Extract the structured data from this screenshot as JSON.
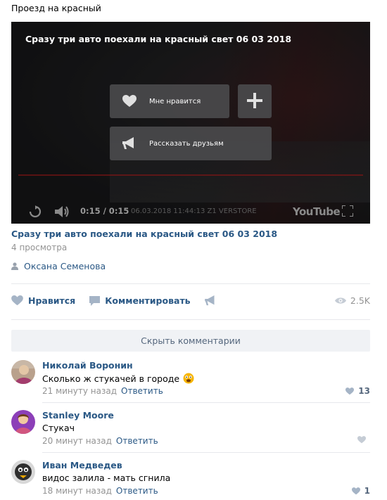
{
  "post": {
    "title": "Проезд на красный"
  },
  "player": {
    "heading": "Сразу три авто поехали на красный свет 06 03 2018",
    "overlay": {
      "like_label": "Мне нравится",
      "share_label": "Рассказать друзьям"
    },
    "time": "0:15 / 0:15",
    "stamp": "06.03.2018 11:44:13 Z1 VERSTORE",
    "brand": "YouTube",
    "progress": 1.0
  },
  "video": {
    "title": "Сразу три авто поехали на красный свет 06 03 2018",
    "views": "4 просмотра",
    "author": "Оксана Семенова"
  },
  "actions": {
    "like_label": "Нравится",
    "comment_label": "Комментировать",
    "views_count": "2.5K"
  },
  "comments_toggle": "Скрыть комментарии",
  "comments": [
    {
      "name": "Николай Воронин",
      "text": "Сколько ж стукачей в городе",
      "time": "21 минуту назад",
      "reply": "Ответить",
      "likes": "13"
    },
    {
      "name": "Stanley Moore",
      "text": "Стукач",
      "time": "20 минут назад",
      "reply": "Ответить",
      "likes": ""
    },
    {
      "name": "Иван Медведев",
      "text": "видос залила - мать сгнила",
      "time": "18 минут назад",
      "reply": "Ответить",
      "likes": "1"
    }
  ],
  "colors": {
    "link": "#2a5885",
    "muted": "#939393",
    "toggle_bg": "#f0f2f5"
  }
}
